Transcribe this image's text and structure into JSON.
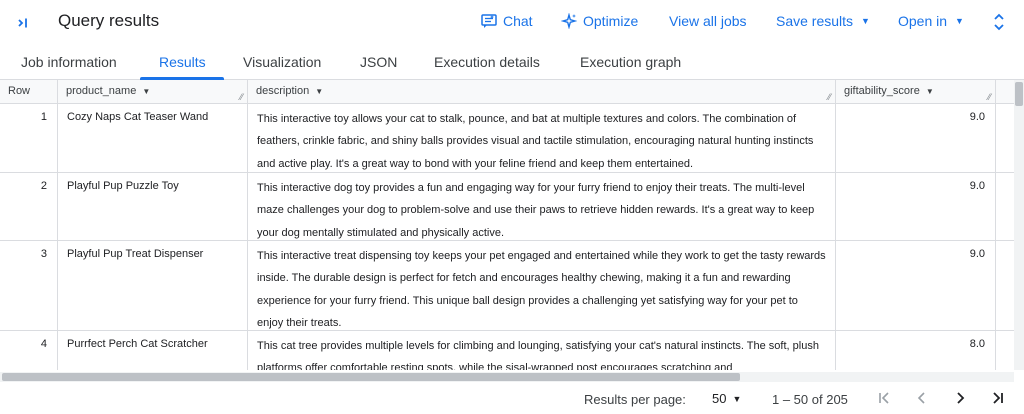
{
  "header": {
    "collapse_icon": "collapse-panel-icon",
    "title": "Query results",
    "chat_label": "Chat",
    "optimize_label": "Optimize",
    "view_all_jobs_label": "View all jobs",
    "save_results_label": "Save results",
    "open_in_label": "Open in"
  },
  "tabs": [
    {
      "label": "Job information",
      "active": false
    },
    {
      "label": "Results",
      "active": true
    },
    {
      "label": "Visualization",
      "active": false
    },
    {
      "label": "JSON",
      "active": false
    },
    {
      "label": "Execution details",
      "active": false
    },
    {
      "label": "Execution graph",
      "active": false
    }
  ],
  "table": {
    "columns": [
      "Row",
      "product_name",
      "description",
      "giftability_score"
    ],
    "rows": [
      {
        "row": "1",
        "product_name": "Cozy Naps Cat Teaser Wand",
        "description": "This interactive toy allows your cat to stalk, pounce, and bat at multiple textures and colors. The combination of feathers, crinkle fabric, and shiny balls provides visual and tactile stimulation, encouraging natural hunting instincts and active play.  It's a great way to bond with your feline friend and keep them entertained.",
        "giftability_score": "9.0"
      },
      {
        "row": "2",
        "product_name": "Playful Pup Puzzle Toy",
        "description": "This interactive dog toy provides a fun and engaging way for your furry friend to enjoy their treats.  The multi-level maze challenges your dog to problem-solve and use their paws to retrieve hidden rewards.  It's a great way to keep your dog mentally stimulated and physically active.",
        "giftability_score": "9.0"
      },
      {
        "row": "3",
        "product_name": "Playful Pup Treat Dispenser",
        "description": "This interactive treat dispensing toy keeps your pet engaged and entertained while they work to get the tasty rewards inside. The durable design is perfect for fetch and encourages healthy chewing, making it a fun and rewarding experience for your furry friend.  This unique ball design provides a challenging yet satisfying way for your pet to enjoy their treats.",
        "giftability_score": "9.0"
      },
      {
        "row": "4",
        "product_name": "Purrfect Perch Cat Scratcher",
        "description": "This cat tree provides multiple levels for climbing and lounging, satisfying your cat's natural instincts. The soft, plush platforms offer comfortable resting spots, while the sisal-wrapped post encourages scratching and",
        "giftability_score": "8.0"
      }
    ]
  },
  "footer": {
    "per_page_label": "Results per page:",
    "per_page_value": "50",
    "range_text": "1 – 50 of 205"
  },
  "colors": {
    "accent": "#1a73e8",
    "border": "#dadce0",
    "header_bg": "#f8f9fa"
  }
}
